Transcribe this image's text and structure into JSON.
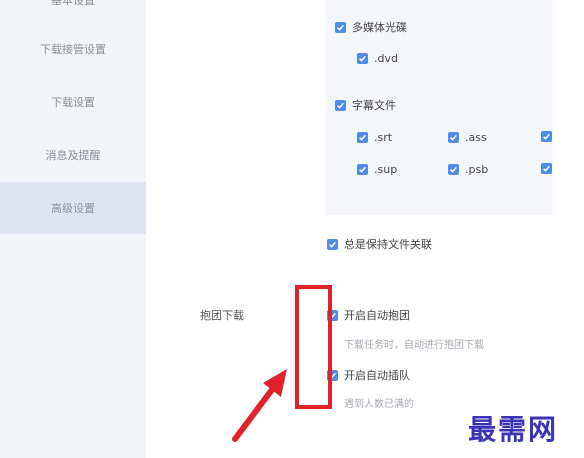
{
  "sidebar": {
    "items": [
      {
        "label": "基本设置"
      },
      {
        "label": "下载接管设置"
      },
      {
        "label": "下载设置"
      },
      {
        "label": "消息及提醒"
      },
      {
        "label": "高级设置"
      }
    ]
  },
  "file_types": {
    "multimedia": {
      "label": "多媒体光碟",
      "dvd": ".dvd"
    },
    "subtitle": {
      "label": "字幕文件",
      "srt": ".srt",
      "ass": ".ass",
      "sup": ".sup",
      "psb": ".psb"
    }
  },
  "always_keep_assoc": "总是保持文件关联",
  "group_download": {
    "section_label": "抱团下载",
    "auto_group": {
      "label": "开启自动抱团",
      "desc": "下载任务时，自动进行抱团下载"
    },
    "auto_queue": {
      "label": "开启自动插队",
      "desc": "遇到人数已满的"
    }
  },
  "watermark": "最需网",
  "colors": {
    "accent": "#4f8de8",
    "highlight": "#e0232a",
    "watermark": "#3a35b6"
  }
}
